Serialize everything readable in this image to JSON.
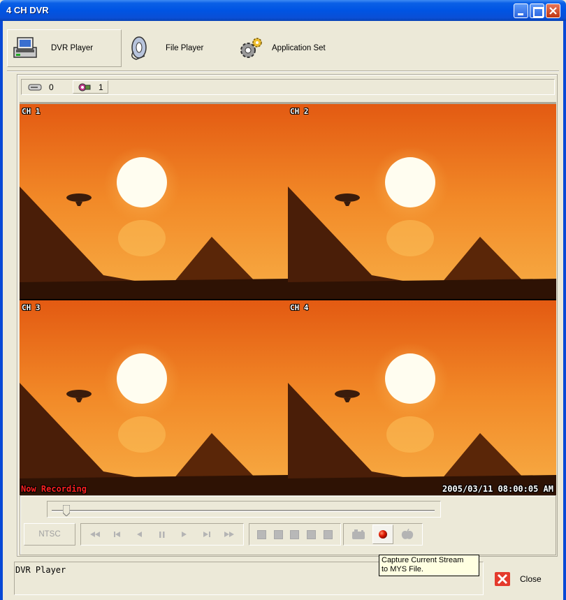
{
  "window": {
    "title": "4 CH DVR",
    "controls": [
      "minimize",
      "maximize",
      "close"
    ]
  },
  "toolbar": {
    "items": [
      {
        "label": "DVR Player",
        "icon": "dvr-player-icon",
        "selected": true
      },
      {
        "label": "File Player",
        "icon": "film-reel-icon",
        "selected": false
      },
      {
        "label": "Application Set",
        "icon": "gear-icon",
        "selected": false
      }
    ]
  },
  "status": {
    "hdd_count": "0",
    "camera_count": "1"
  },
  "channels": [
    {
      "label": "CH 1"
    },
    {
      "label": "CH 2"
    },
    {
      "label": "CH 3"
    },
    {
      "label": "CH 4"
    }
  ],
  "overlay": {
    "recording": "Now Recording",
    "timestamp": "2005/03/11 08:00:05 AM"
  },
  "controls": {
    "video_standard": "NTSC",
    "playback_buttons": [
      "rewind",
      "skip-back",
      "step-back",
      "pause",
      "play",
      "skip-forward",
      "fast-forward"
    ],
    "channel_buttons": [
      "ch1",
      "ch2",
      "ch3",
      "ch4",
      "all"
    ],
    "record_buttons": [
      "snapshot",
      "record",
      "stop-capture"
    ],
    "position": 0.04
  },
  "tooltip": {
    "line1": "Capture Current Stream",
    "line2": "to MYS File."
  },
  "info": {
    "text": "DVR Player"
  },
  "close": {
    "label": "Close"
  },
  "colors": {
    "titlebar": "#0054e3",
    "chrome": "#ece9d8",
    "sky_top": "#e8661a",
    "sky_bottom": "#f6a63c",
    "record_red": "#ff2020"
  }
}
